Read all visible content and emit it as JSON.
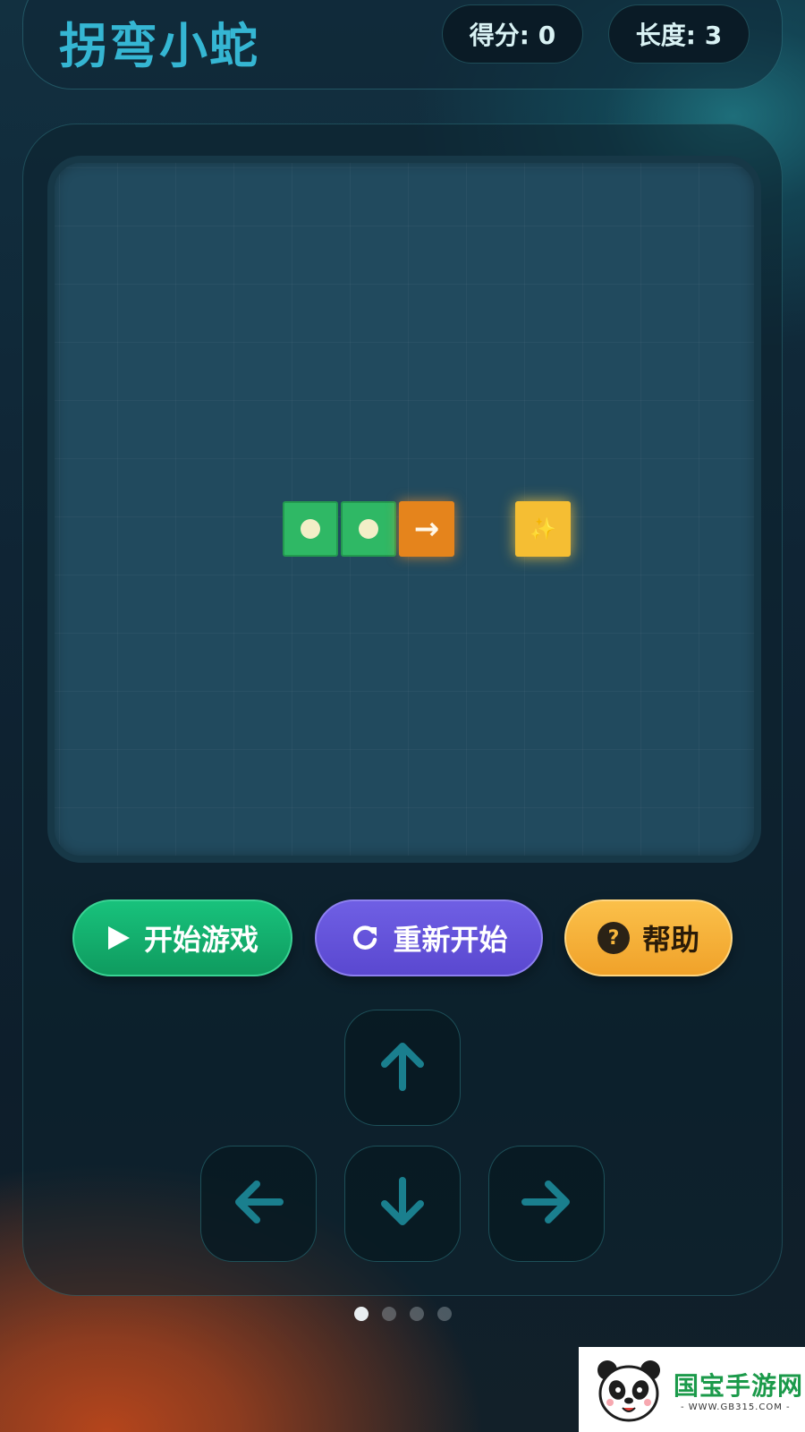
{
  "header": {
    "title": "拐弯小蛇",
    "score_text": "得分: 0",
    "length_text": "长度: 3"
  },
  "game": {
    "score": 0,
    "length": 3,
    "head_direction": "right",
    "head_symbol": "→",
    "food_symbol": "✨",
    "colors": {
      "board": "#214a5e",
      "snake_body": "#2fb865",
      "snake_head": "#e5841c",
      "food": "#f5be33"
    }
  },
  "buttons": {
    "start_label": "开始游戏",
    "restart_label": "重新开始",
    "help_label": "帮助",
    "help_icon_text": "?"
  },
  "controls": {
    "up_icon": "arrow-up-icon",
    "down_icon": "arrow-down-icon",
    "left_icon": "arrow-left-icon",
    "right_icon": "arrow-right-icon"
  },
  "pager": {
    "count": 4,
    "active_index": 0
  },
  "watermark": {
    "text": "国宝手游网",
    "sub": "- WWW.GB315.COM -"
  }
}
